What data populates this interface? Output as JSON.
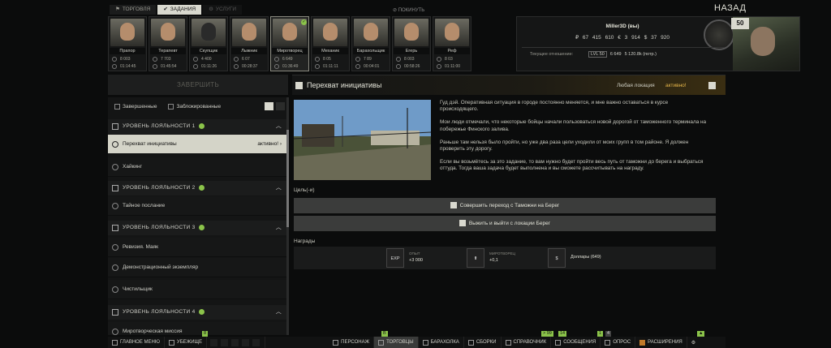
{
  "top_tabs": [
    {
      "label": "ТОРГОВЛЯ",
      "icon": "trade-icon"
    },
    {
      "label": "ЗАДАНИЯ",
      "icon": "tasks-icon"
    },
    {
      "label": "УСЛУГИ",
      "icon": "services-icon"
    }
  ],
  "logout_label": "ПОКИНУТЬ",
  "back_label": "НАЗАД",
  "traders": [
    {
      "name": "Прапор",
      "v1": "8 003",
      "v2": "01:14:45"
    },
    {
      "name": "Терапевт",
      "v1": "7 703",
      "v2": "01:45:54"
    },
    {
      "name": "Скупщик",
      "v1": "4 400",
      "v2": "01:11:26"
    },
    {
      "name": "Лыжник",
      "v1": "6 07",
      "v2": "00:28:37"
    },
    {
      "name": "Миротворец",
      "v1": "6 649",
      "v2": "01:36:49"
    },
    {
      "name": "Механик",
      "v1": "8 05",
      "v2": "01:11:11"
    },
    {
      "name": "Барахольщик",
      "v1": "7 89",
      "v2": "00:04:01"
    },
    {
      "name": "Егерь",
      "v1": "8 003",
      "v2": "00:58:26"
    },
    {
      "name": "Реф",
      "v1": "8 03",
      "v2": "01:11:00"
    }
  ],
  "player": {
    "name": "Miller3D (вы)",
    "money": "₽ 67 415 610   € 3 914   $ 37 920",
    "standing_label": "Текущее отношение:",
    "loyalty_level": "LVL 50",
    "standing": "6 649",
    "spent": "5 120.8k (потр.)",
    "level": "50"
  },
  "finish_label": "ЗАВЕРШИТЬ",
  "quest": {
    "title": "Перехват инициативы",
    "location": "Любая локация",
    "status": "активно!",
    "description": [
      "Гуд дэй. Оперативная ситуация в городе постоянно меняется, и мне важно оставаться в курсе происходящего.",
      "Мои люди отмечали, что некоторые бойцы начали пользоваться новой дорогой от таможенного терминала на побережье Финского залива.",
      "Раньше там нельзя было пройти, но уже два раза цели уходили от моих групп в том районе. Я должен проверить эту дорогу.",
      "Если вы возьмётесь за это задание, то вам нужно будет пройти весь путь от таможни до берега и выбраться оттуда. Тогда ваша задача будет выполнена и вы сможете рассчитывать на награду."
    ],
    "goals_label": "Цель(-и)",
    "objectives": [
      "Совершить переход с Таможни на Берег",
      "Выжить и выйти с локации Берег"
    ],
    "rewards_label": "Награды",
    "rewards": [
      {
        "box": "EXP",
        "label": "ОПЫТ",
        "value": "+3 000"
      },
      {
        "box": "⬆",
        "label": "МИРОТВОРЕЦ",
        "value": "+0,1"
      },
      {
        "box": "$",
        "label": "",
        "value": "Доллары (649)"
      }
    ]
  },
  "filters": {
    "completed": "Завершенные",
    "locked": "Заблокированные"
  },
  "list": {
    "sections": [
      "УРОВЕНЬ ЛОЯЛЬНОСТИ 1",
      "УРОВЕНЬ ЛОЯЛЬНОСТИ 2",
      "УРОВЕНЬ ЛОЯЛЬНОСТИ 3",
      "УРОВЕНЬ ЛОЯЛЬНОСТИ 4"
    ],
    "items": [
      {
        "label": "Перехват инициативы",
        "status": "активно!"
      },
      {
        "label": "Хайкинг"
      },
      {
        "label": "Тайное послание"
      },
      {
        "label": "Ревизия. Маяк"
      },
      {
        "label": "Демонстрационный экземпляр"
      },
      {
        "label": "Чистильщик"
      },
      {
        "label": "Миротворческая миссия"
      }
    ]
  },
  "bottom_bar": {
    "main_menu": "ГЛАВНОЕ МЕНЮ",
    "hideout": "УБЕЖИЩЕ",
    "character": "ПЕРСОНАЖ",
    "traders": "ТОРГОВЦЫ",
    "flea": "БАРАХОЛКА",
    "builds": "СБОРКИ",
    "handbook": "СПРАВОЧНИК",
    "messages": "СООБЩЕНИЯ",
    "survey": "ОПРОС",
    "extensions": "РАСШИРЕНИЯ",
    "indicators": [
      "8",
      "B",
      "> 99",
      "14",
      "1",
      "4"
    ]
  },
  "colors": {
    "accent_green": "#8bc34a",
    "status_orange": "#e8b84a",
    "selected_bg": "#d4d4c8"
  }
}
